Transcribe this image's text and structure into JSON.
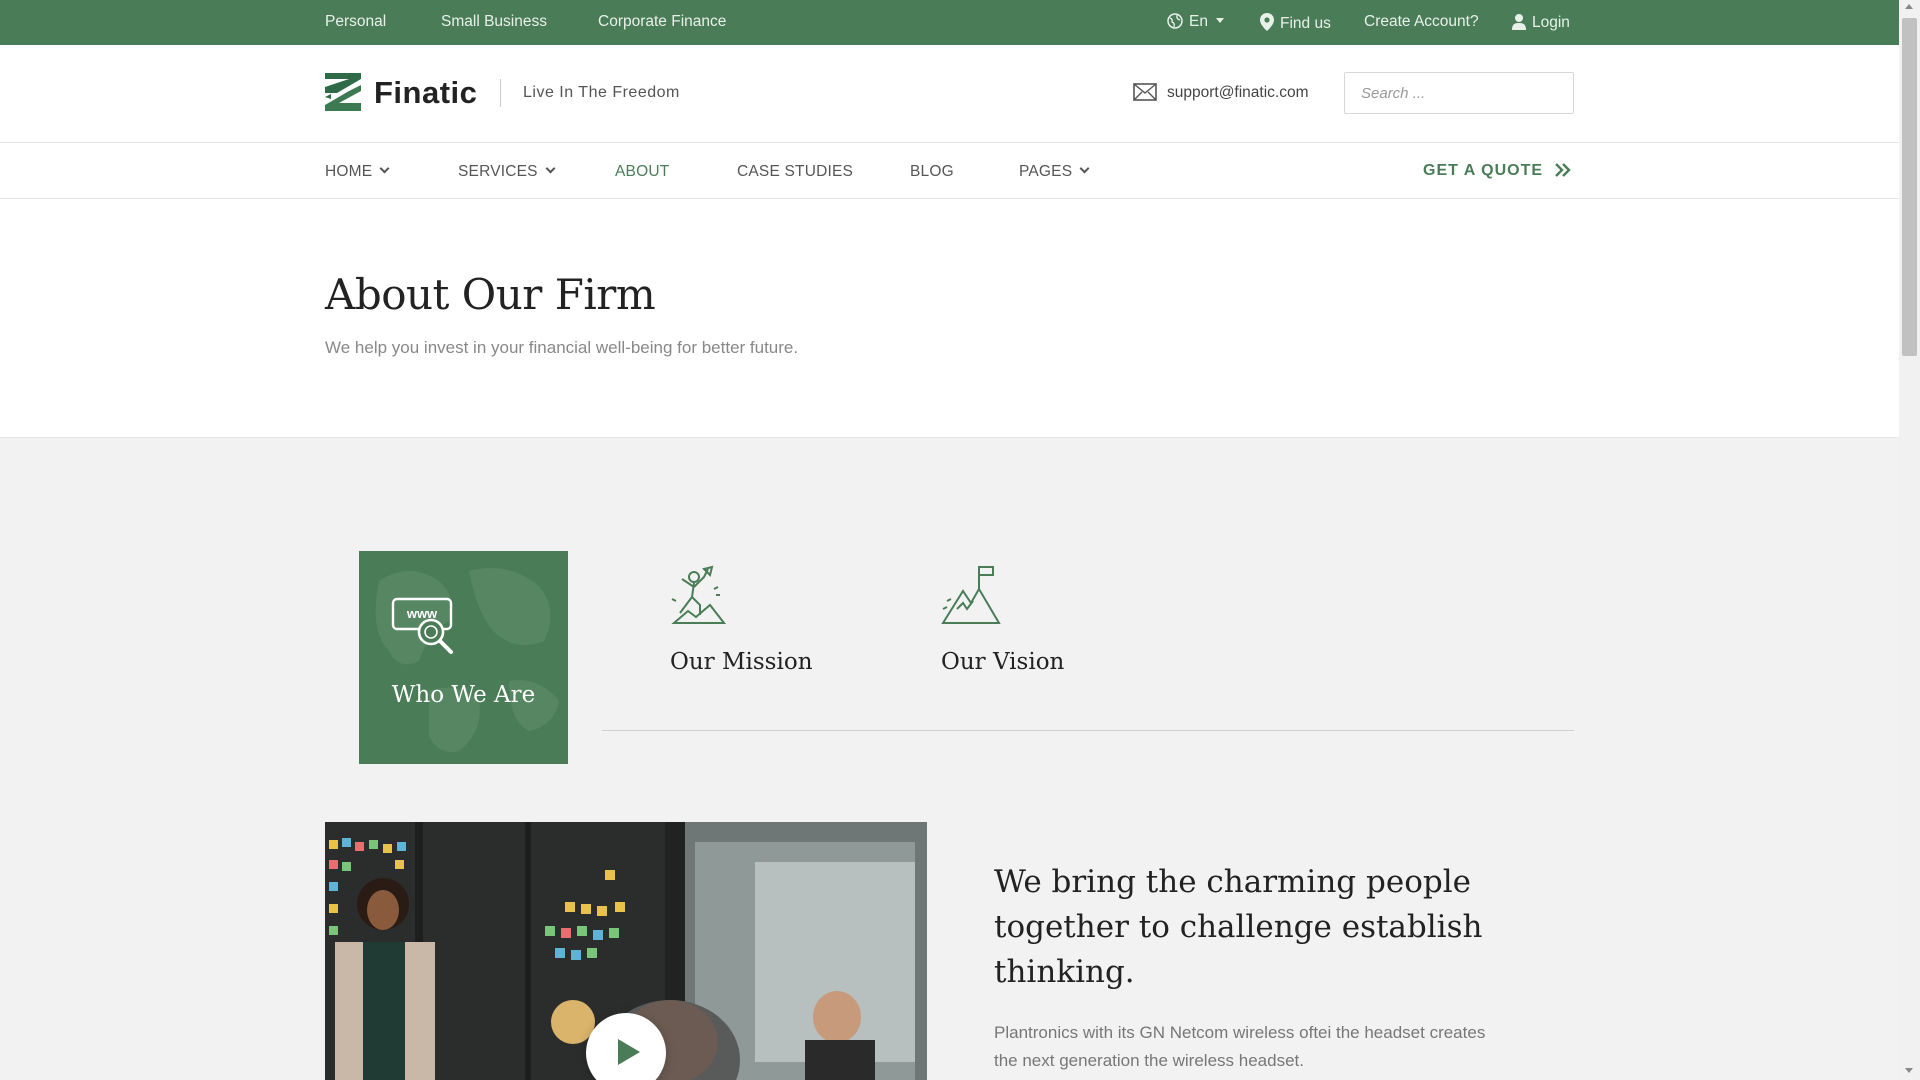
{
  "topbar": {
    "links": [
      "Personal",
      "Small Business",
      "Corporate Finance"
    ],
    "language": "En",
    "find_us": "Find us",
    "create_account": "Create Account?",
    "login": "Login"
  },
  "header": {
    "brand": "Finatic",
    "tagline": "Live In The Freedom",
    "email": "support@finatic.com",
    "search_placeholder": "Search ..."
  },
  "nav": {
    "items": [
      {
        "label": "HOME",
        "dropdown": true
      },
      {
        "label": "SERVICES",
        "dropdown": true
      },
      {
        "label": "ABOUT",
        "active": true
      },
      {
        "label": "CASE STUDIES"
      },
      {
        "label": "BLOG"
      },
      {
        "label": "PAGES",
        "dropdown": true
      }
    ],
    "cta": "GET A QUOTE"
  },
  "hero": {
    "title": "About Our Firm",
    "subtitle": "We help you invest in your financial well-being for better future."
  },
  "tabs": [
    {
      "label": "Who We Are",
      "icon": "www-search-icon",
      "active": true
    },
    {
      "label": "Our Mission",
      "icon": "climber-icon"
    },
    {
      "label": "Our Vision",
      "icon": "mountain-flag-icon"
    }
  ],
  "content": {
    "headline": "We bring the charming people together to challenge establish thinking.",
    "body": "Plantronics with its GN Netcom wireless oftei the headset creates the next generation the wireless headset."
  },
  "colors": {
    "brand_green": "#4a7d57",
    "text_dark": "#222222",
    "text_muted": "#888888"
  }
}
